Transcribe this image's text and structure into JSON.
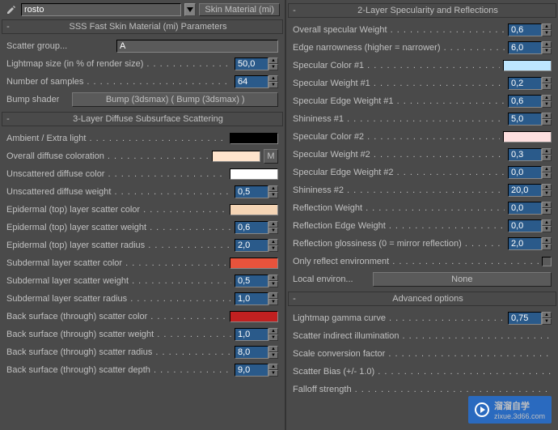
{
  "header": {
    "name": "rosto",
    "type": "Skin Material (mi)"
  },
  "sections": {
    "sss_params": {
      "title": "SSS Fast Skin Material (mi) Parameters"
    },
    "layer3": {
      "title": "3-Layer Diffuse Subsurface Scattering"
    },
    "layer2": {
      "title": "2-Layer Specularity and Reflections"
    },
    "advanced": {
      "title": "Advanced options"
    }
  },
  "params": {
    "scatter_group": {
      "label": "Scatter group...",
      "value": "A"
    },
    "lightmap_size": {
      "label": "Lightmap size (in % of render size)",
      "value": "50,0"
    },
    "num_samples": {
      "label": "Number of samples",
      "value": "64"
    },
    "bump_shader": {
      "label": "Bump shader",
      "button": "Bump (3dsmax)  ( Bump (3dsmax) )"
    },
    "ambient": {
      "label": "Ambient / Extra light",
      "color": "#000000"
    },
    "overall_diffuse": {
      "label": "Overall diffuse coloration",
      "color": "#ffe4cc",
      "extra": "M"
    },
    "unscattered_color": {
      "label": "Unscattered diffuse color",
      "color": "#ffffff"
    },
    "unscattered_weight": {
      "label": "Unscattered diffuse weight",
      "value": "0,5"
    },
    "epi_color": {
      "label": "Epidermal (top) layer scatter color",
      "color": "#f5d5b5"
    },
    "epi_weight": {
      "label": "Epidermal (top) layer scatter weight",
      "value": "0,6"
    },
    "epi_radius": {
      "label": "Epidermal (top) layer scatter radius",
      "value": "2,0"
    },
    "sub_color": {
      "label": "Subdermal layer scatter color",
      "color": "#e8533c"
    },
    "sub_weight": {
      "label": "Subdermal layer scatter weight",
      "value": "0,5"
    },
    "sub_radius": {
      "label": "Subdermal layer scatter radius",
      "value": "1,0"
    },
    "back_color": {
      "label": "Back surface (through) scatter color",
      "color": "#c02020"
    },
    "back_weight": {
      "label": "Back surface (through) scatter weight",
      "value": "1,0"
    },
    "back_radius": {
      "label": "Back surface (through) scatter radius",
      "value": "8,0"
    },
    "back_depth": {
      "label": "Back surface (through) scatter depth",
      "value": "9,0"
    },
    "overall_spec": {
      "label": "Overall specular Weight",
      "value": "0,6"
    },
    "edge_narrow": {
      "label": "Edge narrowness (higher = narrower)",
      "value": "6,0"
    },
    "spec_color1": {
      "label": "Specular Color #1",
      "color": "#bde6ff"
    },
    "spec_weight1": {
      "label": "Specular Weight #1",
      "value": "0,2"
    },
    "spec_edge1": {
      "label": "Specular Edge Weight #1",
      "value": "0,6"
    },
    "shininess1": {
      "label": "Shininess #1",
      "value": "5,0"
    },
    "spec_color2": {
      "label": "Specular Color #2",
      "color": "#ffe0e0"
    },
    "spec_weight2": {
      "label": "Specular Weight #2",
      "value": "0,3"
    },
    "spec_edge2": {
      "label": "Specular Edge Weight #2",
      "value": "0,0"
    },
    "shininess2": {
      "label": "Shininess #2",
      "value": "20,0"
    },
    "refl_weight": {
      "label": "Reflection Weight",
      "value": "0,0"
    },
    "refl_edge": {
      "label": "Reflection Edge Weight",
      "value": "0,0"
    },
    "refl_gloss": {
      "label": "Reflection glossiness (0 = mirror reflection)",
      "value": "2,0"
    },
    "only_reflect": {
      "label": "Only reflect environment"
    },
    "local_env": {
      "label": "Local environ...",
      "button": "None"
    },
    "gamma": {
      "label": "Lightmap gamma curve",
      "value": "0,75"
    },
    "scatter_indirect": {
      "label": "Scatter indirect illumination"
    },
    "scale_conv": {
      "label": "Scale conversion factor"
    },
    "scatter_bias": {
      "label": "Scatter Bias (+/- 1.0)"
    },
    "falloff": {
      "label": "Falloff strength"
    }
  },
  "watermark": {
    "main": "溜溜自学",
    "sub": "zixue.3d66.com"
  }
}
